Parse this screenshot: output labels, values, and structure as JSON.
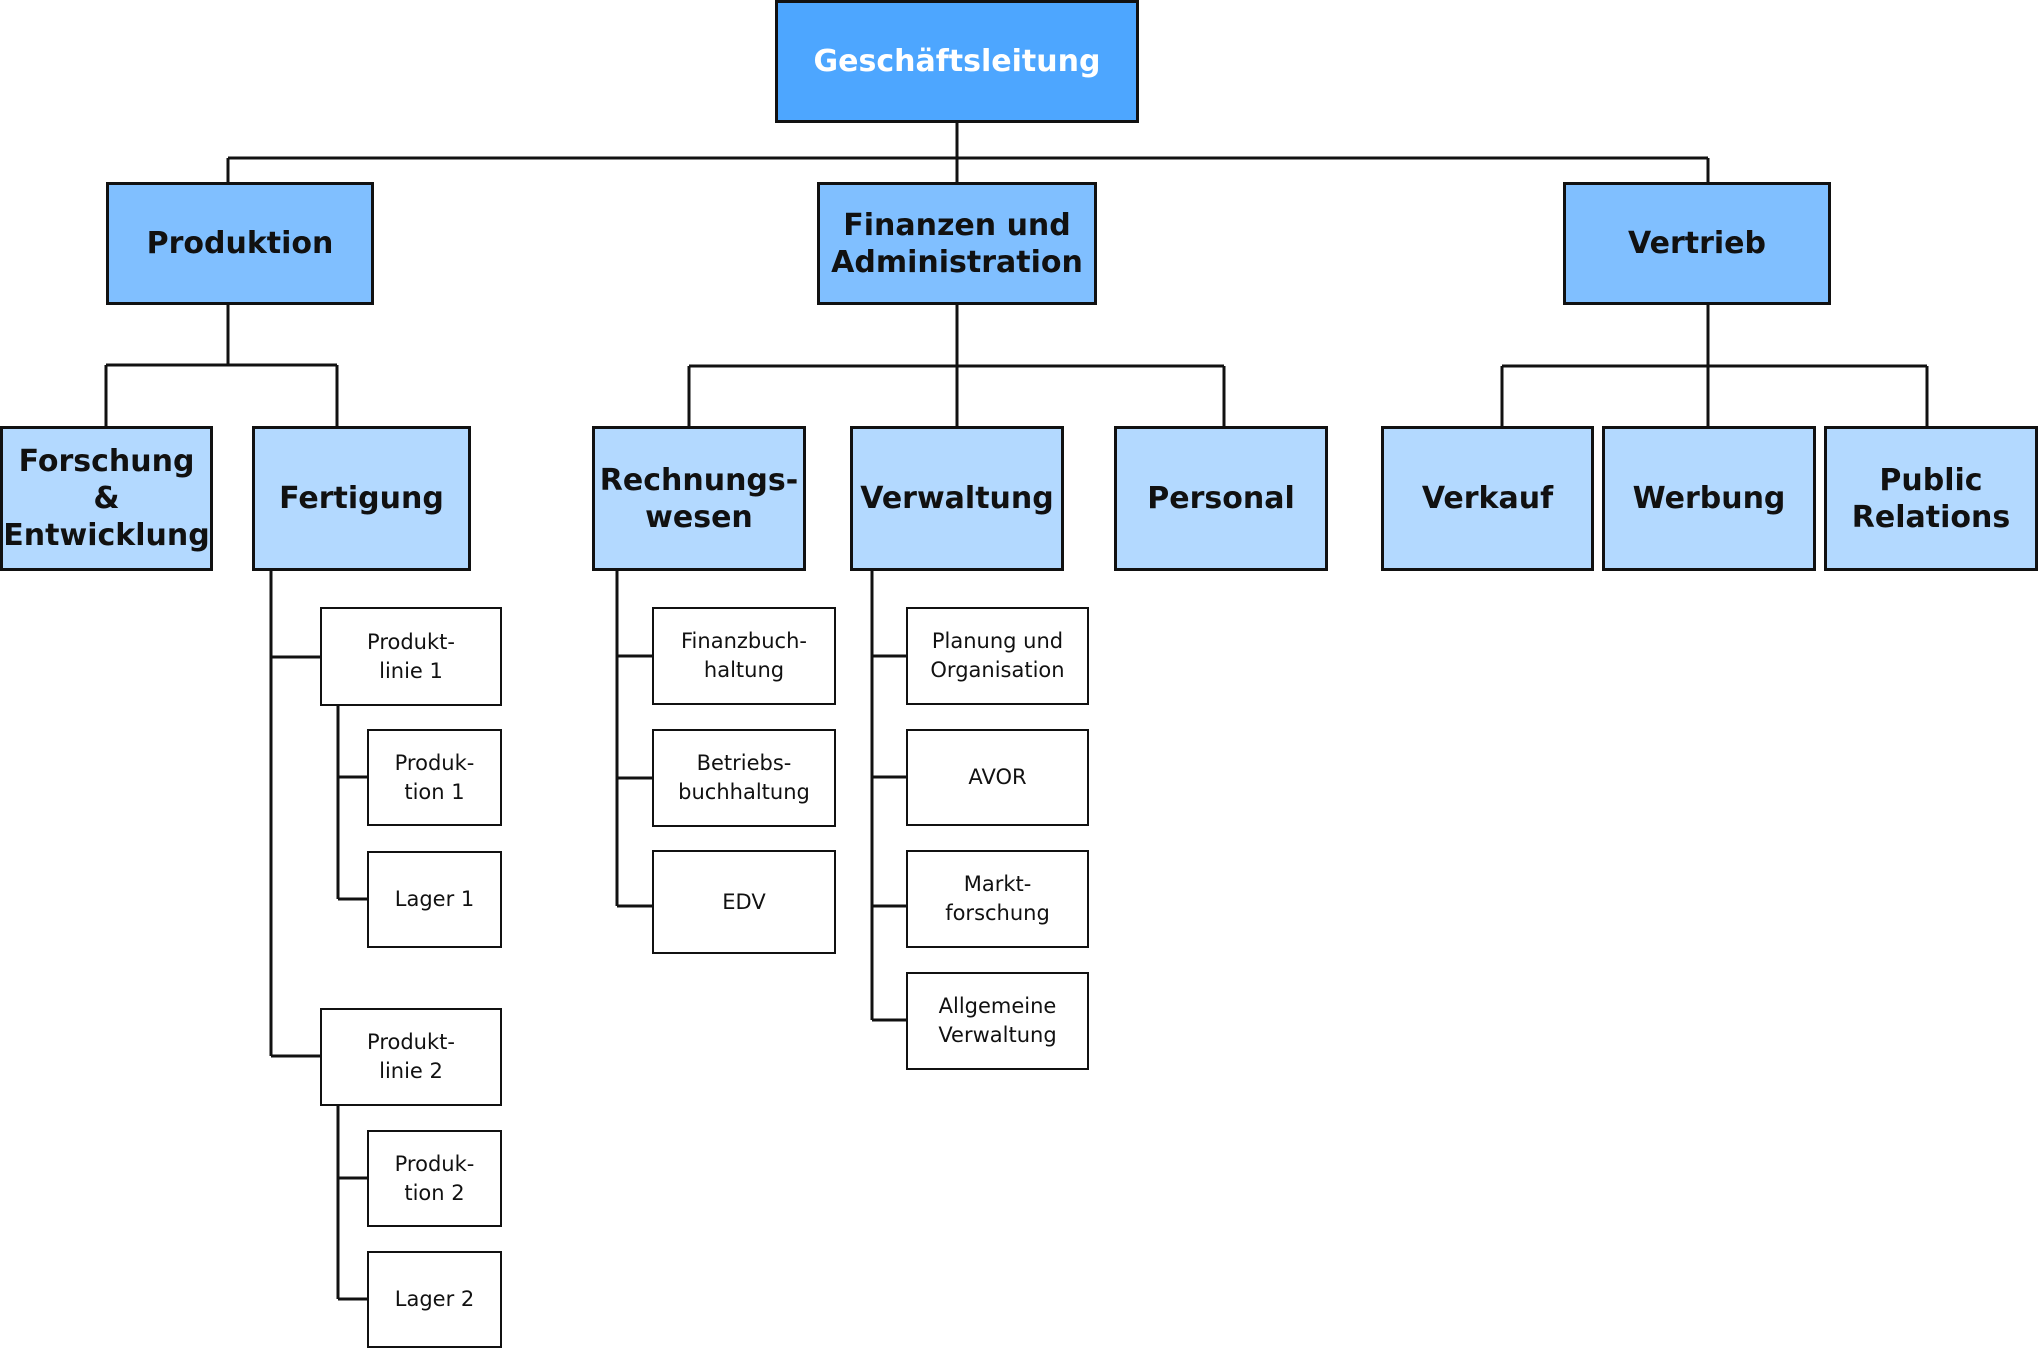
{
  "diagram": {
    "type": "org-chart",
    "colors": {
      "top": "#4DA6FF",
      "level2": "#80BFFF",
      "level3": "#B3D9FF",
      "level4": "#FFFFFF",
      "line": "#111111"
    },
    "root": {
      "label": "Geschäftsleitung"
    },
    "divisions": [
      {
        "label": "Produktion",
        "departments": [
          {
            "label": "Forschung &\nEntwicklung",
            "units": []
          },
          {
            "label": "Fertigung",
            "units": [
              {
                "label": "Produkt-\nlinie 1",
                "children": [
                  {
                    "label": "Produk-\ntion 1"
                  },
                  {
                    "label": "Lager 1"
                  }
                ]
              },
              {
                "label": "Produkt-\nlinie 2",
                "children": [
                  {
                    "label": "Produk-\ntion 2"
                  },
                  {
                    "label": "Lager 2"
                  }
                ]
              }
            ]
          }
        ]
      },
      {
        "label": "Finanzen und\nAdministration",
        "departments": [
          {
            "label": "Rechnungs-\nwesen",
            "units": [
              {
                "label": "Finanzbuch-\nhaltung"
              },
              {
                "label": "Betriebs-\nbuchhaltung"
              },
              {
                "label": "EDV"
              }
            ]
          },
          {
            "label": "Verwaltung",
            "units": [
              {
                "label": "Planung und\nOrganisation"
              },
              {
                "label": "AVOR"
              },
              {
                "label": "Markt-\nforschung"
              },
              {
                "label": "Allgemeine\nVerwaltung"
              }
            ]
          },
          {
            "label": "Personal",
            "units": []
          }
        ]
      },
      {
        "label": "Vertrieb",
        "departments": [
          {
            "label": "Verkauf",
            "units": []
          },
          {
            "label": "Werbung",
            "units": []
          },
          {
            "label": "Public\nRelations",
            "units": []
          }
        ]
      }
    ]
  }
}
